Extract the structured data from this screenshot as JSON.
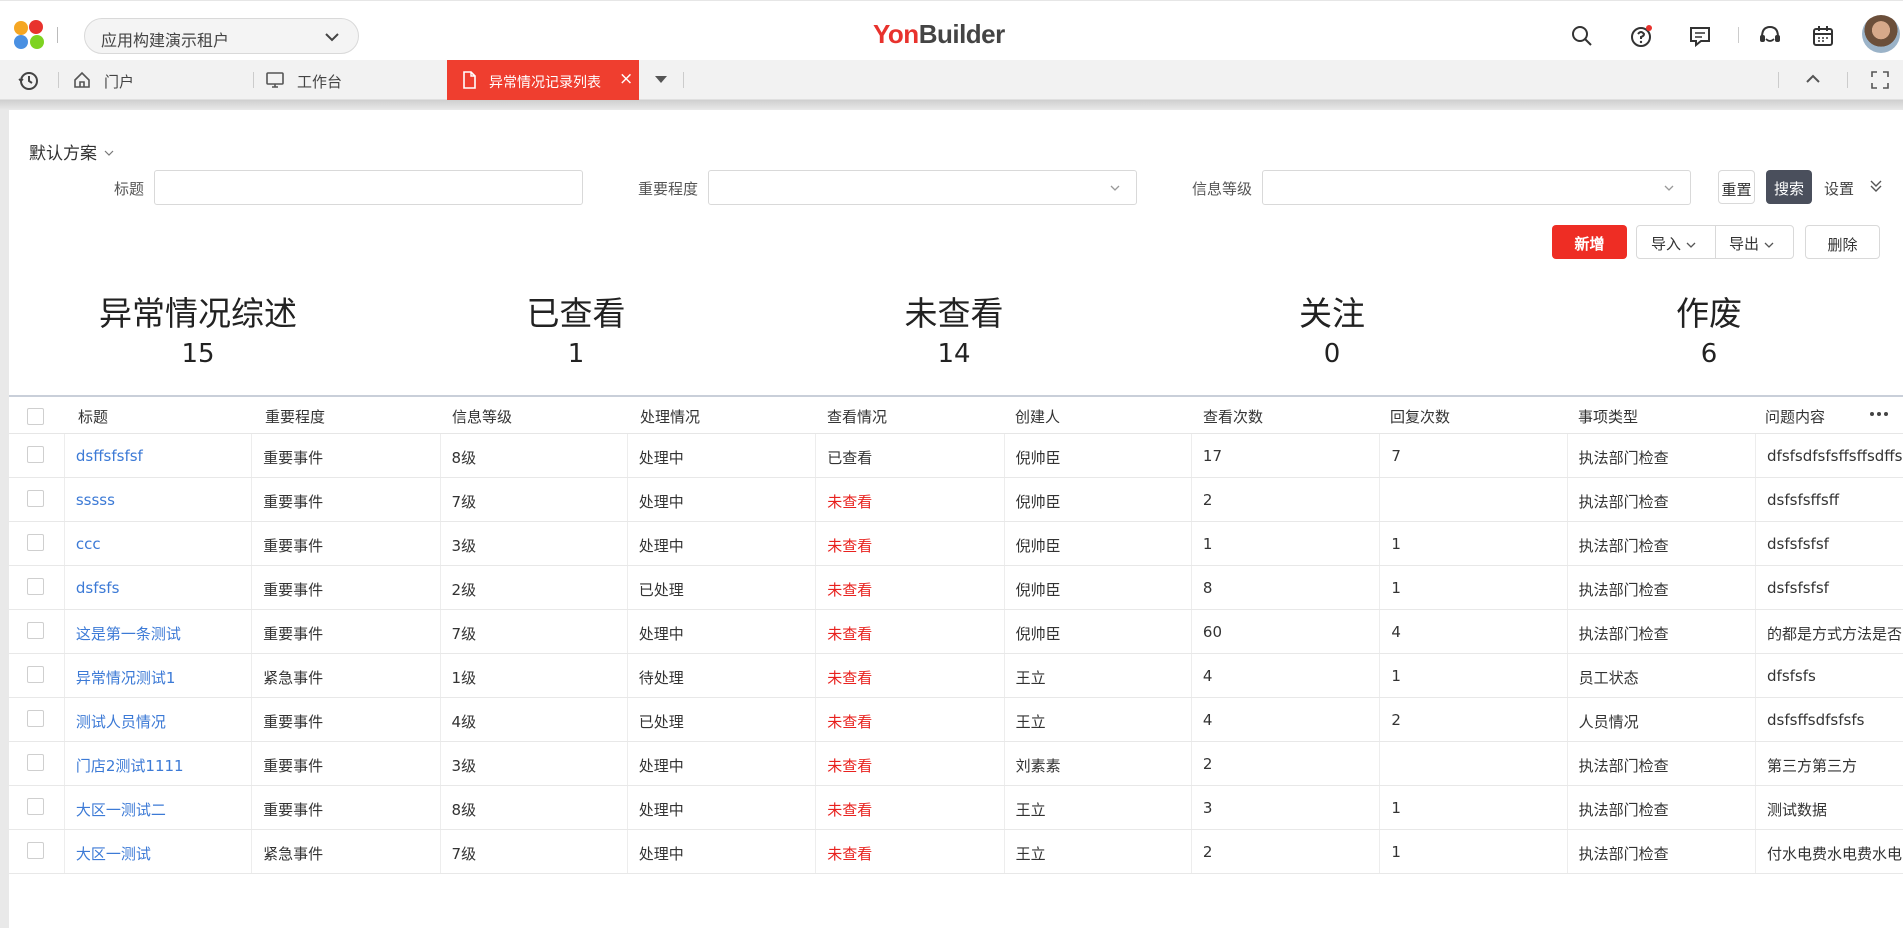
{
  "header": {
    "tenant": "应用构建演示租户",
    "brand_yon": "Yon",
    "brand_builder": "Builder",
    "icons": [
      "search-icon",
      "help-icon",
      "message-icon",
      "customer-service-icon",
      "calendar-icon"
    ]
  },
  "tabs": {
    "home": "门户",
    "workbench": "工作台",
    "active": "异常情况记录列表",
    "close": "×"
  },
  "filter": {
    "scheme": "默认方案",
    "title_label": "标题",
    "importance_label": "重要程度",
    "level_label": "信息等级",
    "reset": "重置",
    "search": "搜索",
    "settings": "设置"
  },
  "toolbar": {
    "add": "新增",
    "import": "导入",
    "export": "导出",
    "delete": "删除"
  },
  "stats": [
    {
      "label": "异常情况综述",
      "value": "15"
    },
    {
      "label": "已查看",
      "value": "1"
    },
    {
      "label": "未查看",
      "value": "14"
    },
    {
      "label": "关注",
      "value": "0"
    },
    {
      "label": "作废",
      "value": "6"
    }
  ],
  "table": {
    "columns": [
      "标题",
      "重要程度",
      "信息等级",
      "处理情况",
      "查看情况",
      "创建人",
      "查看次数",
      "回复次数",
      "事项类型",
      "问题内容"
    ],
    "rows": [
      [
        "dsffsfsfsf",
        "重要事件",
        "8级",
        "处理中",
        "已查看",
        "倪帅臣",
        "17",
        "7",
        "执法部门检查",
        "dfsfsdfsfsffsffsdffs"
      ],
      [
        "sssss",
        "重要事件",
        "7级",
        "处理中",
        "未查看",
        "倪帅臣",
        "2",
        "",
        "执法部门检查",
        "dsfsfsffsff"
      ],
      [
        "ccc",
        "重要事件",
        "3级",
        "处理中",
        "未查看",
        "倪帅臣",
        "1",
        "1",
        "执法部门检查",
        "dsfsfsfsf"
      ],
      [
        "dsfsfs",
        "重要事件",
        "2级",
        "已处理",
        "未查看",
        "倪帅臣",
        "8",
        "1",
        "执法部门检查",
        "dsfsfsfsf"
      ],
      [
        "这是第一条测试",
        "重要事件",
        "7级",
        "处理中",
        "未查看",
        "倪帅臣",
        "60",
        "4",
        "执法部门检查",
        "的都是方式方法是否"
      ],
      [
        "异常情况测试1",
        "紧急事件",
        "1级",
        "待处理",
        "未查看",
        "王立",
        "4",
        "1",
        "员工状态",
        "dfsfsfs"
      ],
      [
        "测试人员情况",
        "重要事件",
        "4级",
        "已处理",
        "未查看",
        "王立",
        "4",
        "2",
        "人员情况",
        "dsfsffsdfsfsfs"
      ],
      [
        "门店2测试1111",
        "重要事件",
        "3级",
        "处理中",
        "未查看",
        "刘素素",
        "2",
        "",
        "执法部门检查",
        "第三方第三方"
      ],
      [
        "大区一测试二",
        "重要事件",
        "8级",
        "处理中",
        "未查看",
        "王立",
        "3",
        "1",
        "执法部门检查",
        "测试数据"
      ],
      [
        "大区一测试",
        "紧急事件",
        "7级",
        "处理中",
        "未查看",
        "王立",
        "2",
        "1",
        "执法部门检查",
        "付水电费水电费水电"
      ]
    ]
  },
  "colors": {
    "accent": "#ef3e2f",
    "link": "#3c7ad6",
    "unviewed": "#e8211e",
    "search_button": "#4a4f5c"
  }
}
